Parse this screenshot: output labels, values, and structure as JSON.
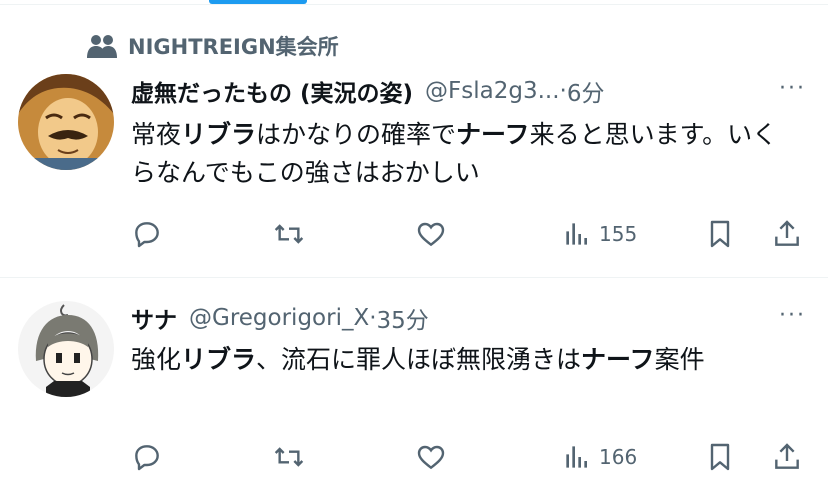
{
  "community": {
    "name": "NIGHTREIGN集会所",
    "icon": "community-icon"
  },
  "tweets": [
    {
      "name": "虚無だったもの (実況の姿)",
      "handle": "@Fsla2g3...",
      "separator": "·",
      "time": "6分",
      "more": "···",
      "text_segments": [
        "常夜",
        "リブラ",
        "はかなりの確率で",
        "ナーフ",
        "来ると思います。いくらなんでもこの強さはおかしい"
      ],
      "views": "155"
    },
    {
      "name": "サナ",
      "handle": "@Gregorigori_X",
      "separator": "·",
      "time": "35分",
      "more": "···",
      "text_segments": [
        "強化",
        "リブラ",
        "、流石に罪人ほぼ無限湧きは",
        "ナーフ",
        "案件"
      ],
      "views": "166"
    }
  ],
  "colors": {
    "accent": "#1d9bf0",
    "secondary_text": "#536471",
    "primary_text": "#0f1419",
    "divider": "#eff3f4"
  }
}
